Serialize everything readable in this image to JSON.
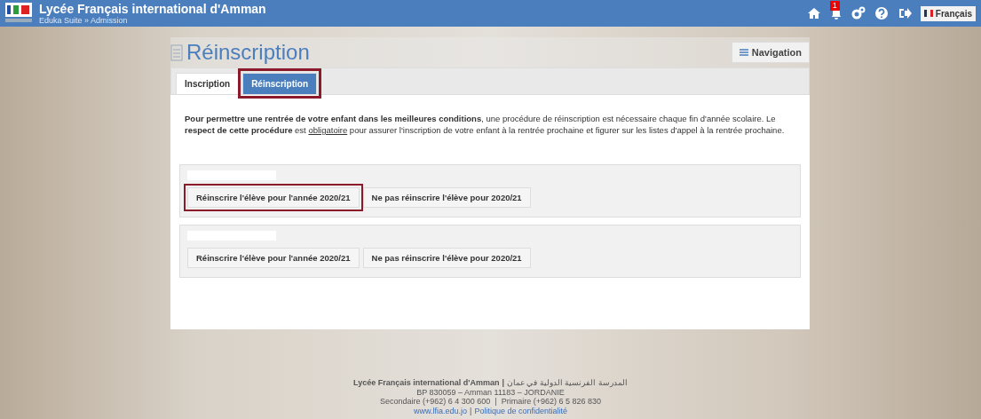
{
  "header": {
    "title": "Lycée Français international d'Amman",
    "breadcrumb": "Eduka Suite » Admission",
    "notification_count": "1",
    "language": "Français"
  },
  "page": {
    "title": "Réinscription",
    "navigation_button": "Navigation"
  },
  "tabs": [
    {
      "label": "Inscription",
      "selected": false,
      "highlighted": false
    },
    {
      "label": "Réinscription",
      "selected": true,
      "highlighted": true
    }
  ],
  "intro": [
    {
      "kind": "bold",
      "text": "Pour permettre une rentrée de votre enfant dans les meilleures conditions"
    },
    {
      "kind": "plain",
      "text": ", une procédure de réinscription est nécessaire chaque fin d'année scolaire. Le "
    },
    {
      "kind": "bold",
      "text": "respect de cette procédure"
    },
    {
      "kind": "plain",
      "text": " est "
    },
    {
      "kind": "underline",
      "text": "obligatoire"
    },
    {
      "kind": "plain",
      "text": " pour assurer l'inscription de votre enfant à la rentrée prochaine et figurer sur les listes d'appel à la rentrée prochaine."
    }
  ],
  "students": [
    {
      "buttons": [
        {
          "label": "Réinscrire l'élève pour l'année 2020/21",
          "highlighted": true
        },
        {
          "label": "Ne pas réinscrire l'élève pour 2020/21",
          "highlighted": false
        }
      ]
    },
    {
      "buttons": [
        {
          "label": "Réinscrire l'élève pour l'année 2020/21",
          "highlighted": false
        },
        {
          "label": "Ne pas réinscrire l'élève pour 2020/21",
          "highlighted": false
        }
      ]
    }
  ],
  "footer": {
    "school": "Lycée Français international d'Amman",
    "school_separator": "|",
    "arabic_name": "المدرسة الفرنسية الدولية في عمان",
    "address": "BP 830059 – Amman 11183 – JORDANIE",
    "phones": "Secondaire (+962) 6 4 300 600  |  Primaire (+962) 6 5 826 830",
    "website": "www.lfia.edu.jo",
    "link_separator": "|",
    "privacy": "Politique de confidentialité"
  }
}
